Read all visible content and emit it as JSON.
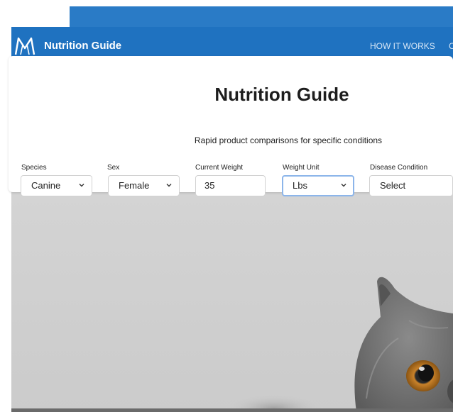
{
  "app": {
    "brand": "Nutrition Guide",
    "nav_links": [
      "HOW IT WORKS",
      "C"
    ]
  },
  "card": {
    "title": "Nutrition Guide",
    "subtitle": "Rapid product comparisons for specific conditions",
    "fields": [
      {
        "label": "Species",
        "type": "select",
        "value": "Canine"
      },
      {
        "label": "Sex",
        "type": "select",
        "value": "Female"
      },
      {
        "label": "Current Weight",
        "type": "input",
        "value": "35"
      },
      {
        "label": "Weight Unit",
        "type": "select",
        "value": "Lbs",
        "focused": true
      },
      {
        "label": "Disease Condition",
        "type": "select",
        "value": "Select"
      }
    ]
  },
  "colors": {
    "nav": "#1f72c0",
    "top_strip": "#2a7bc6",
    "focus_ring": "#8cb5ea",
    "hero_background": "#d3d3d3"
  },
  "icons": {
    "logo": "m-logo-icon",
    "select_chevron": "chevron-down-icon"
  }
}
